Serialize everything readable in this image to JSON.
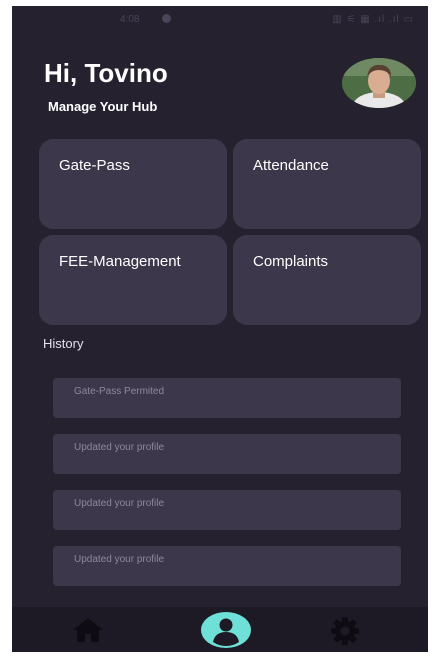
{
  "status_bar": {
    "time": "4:08",
    "icons_text": "▥ ⚟ ▦ .ıl .ıl ▭"
  },
  "header": {
    "greeting": "Hi, Tovino",
    "subtitle": "Manage Your Hub"
  },
  "cards": [
    {
      "label": "Gate-Pass"
    },
    {
      "label": "Attendance"
    },
    {
      "label": "FEE-Management"
    },
    {
      "label": "Complaints"
    }
  ],
  "history": {
    "title": "History",
    "items": [
      {
        "text": "Gate-Pass Permited"
      },
      {
        "text": "Updated your profile"
      },
      {
        "text": "Updated your profile"
      },
      {
        "text": "Updated your profile"
      }
    ]
  },
  "bottom_nav": [
    {
      "icon": "home-icon"
    },
    {
      "icon": "profile-icon"
    },
    {
      "icon": "gear-icon"
    }
  ],
  "colors": {
    "background": "#25212f",
    "card": "#3c374b",
    "nav_bar": "#1d1a25",
    "accent": "#6ee0d7"
  }
}
